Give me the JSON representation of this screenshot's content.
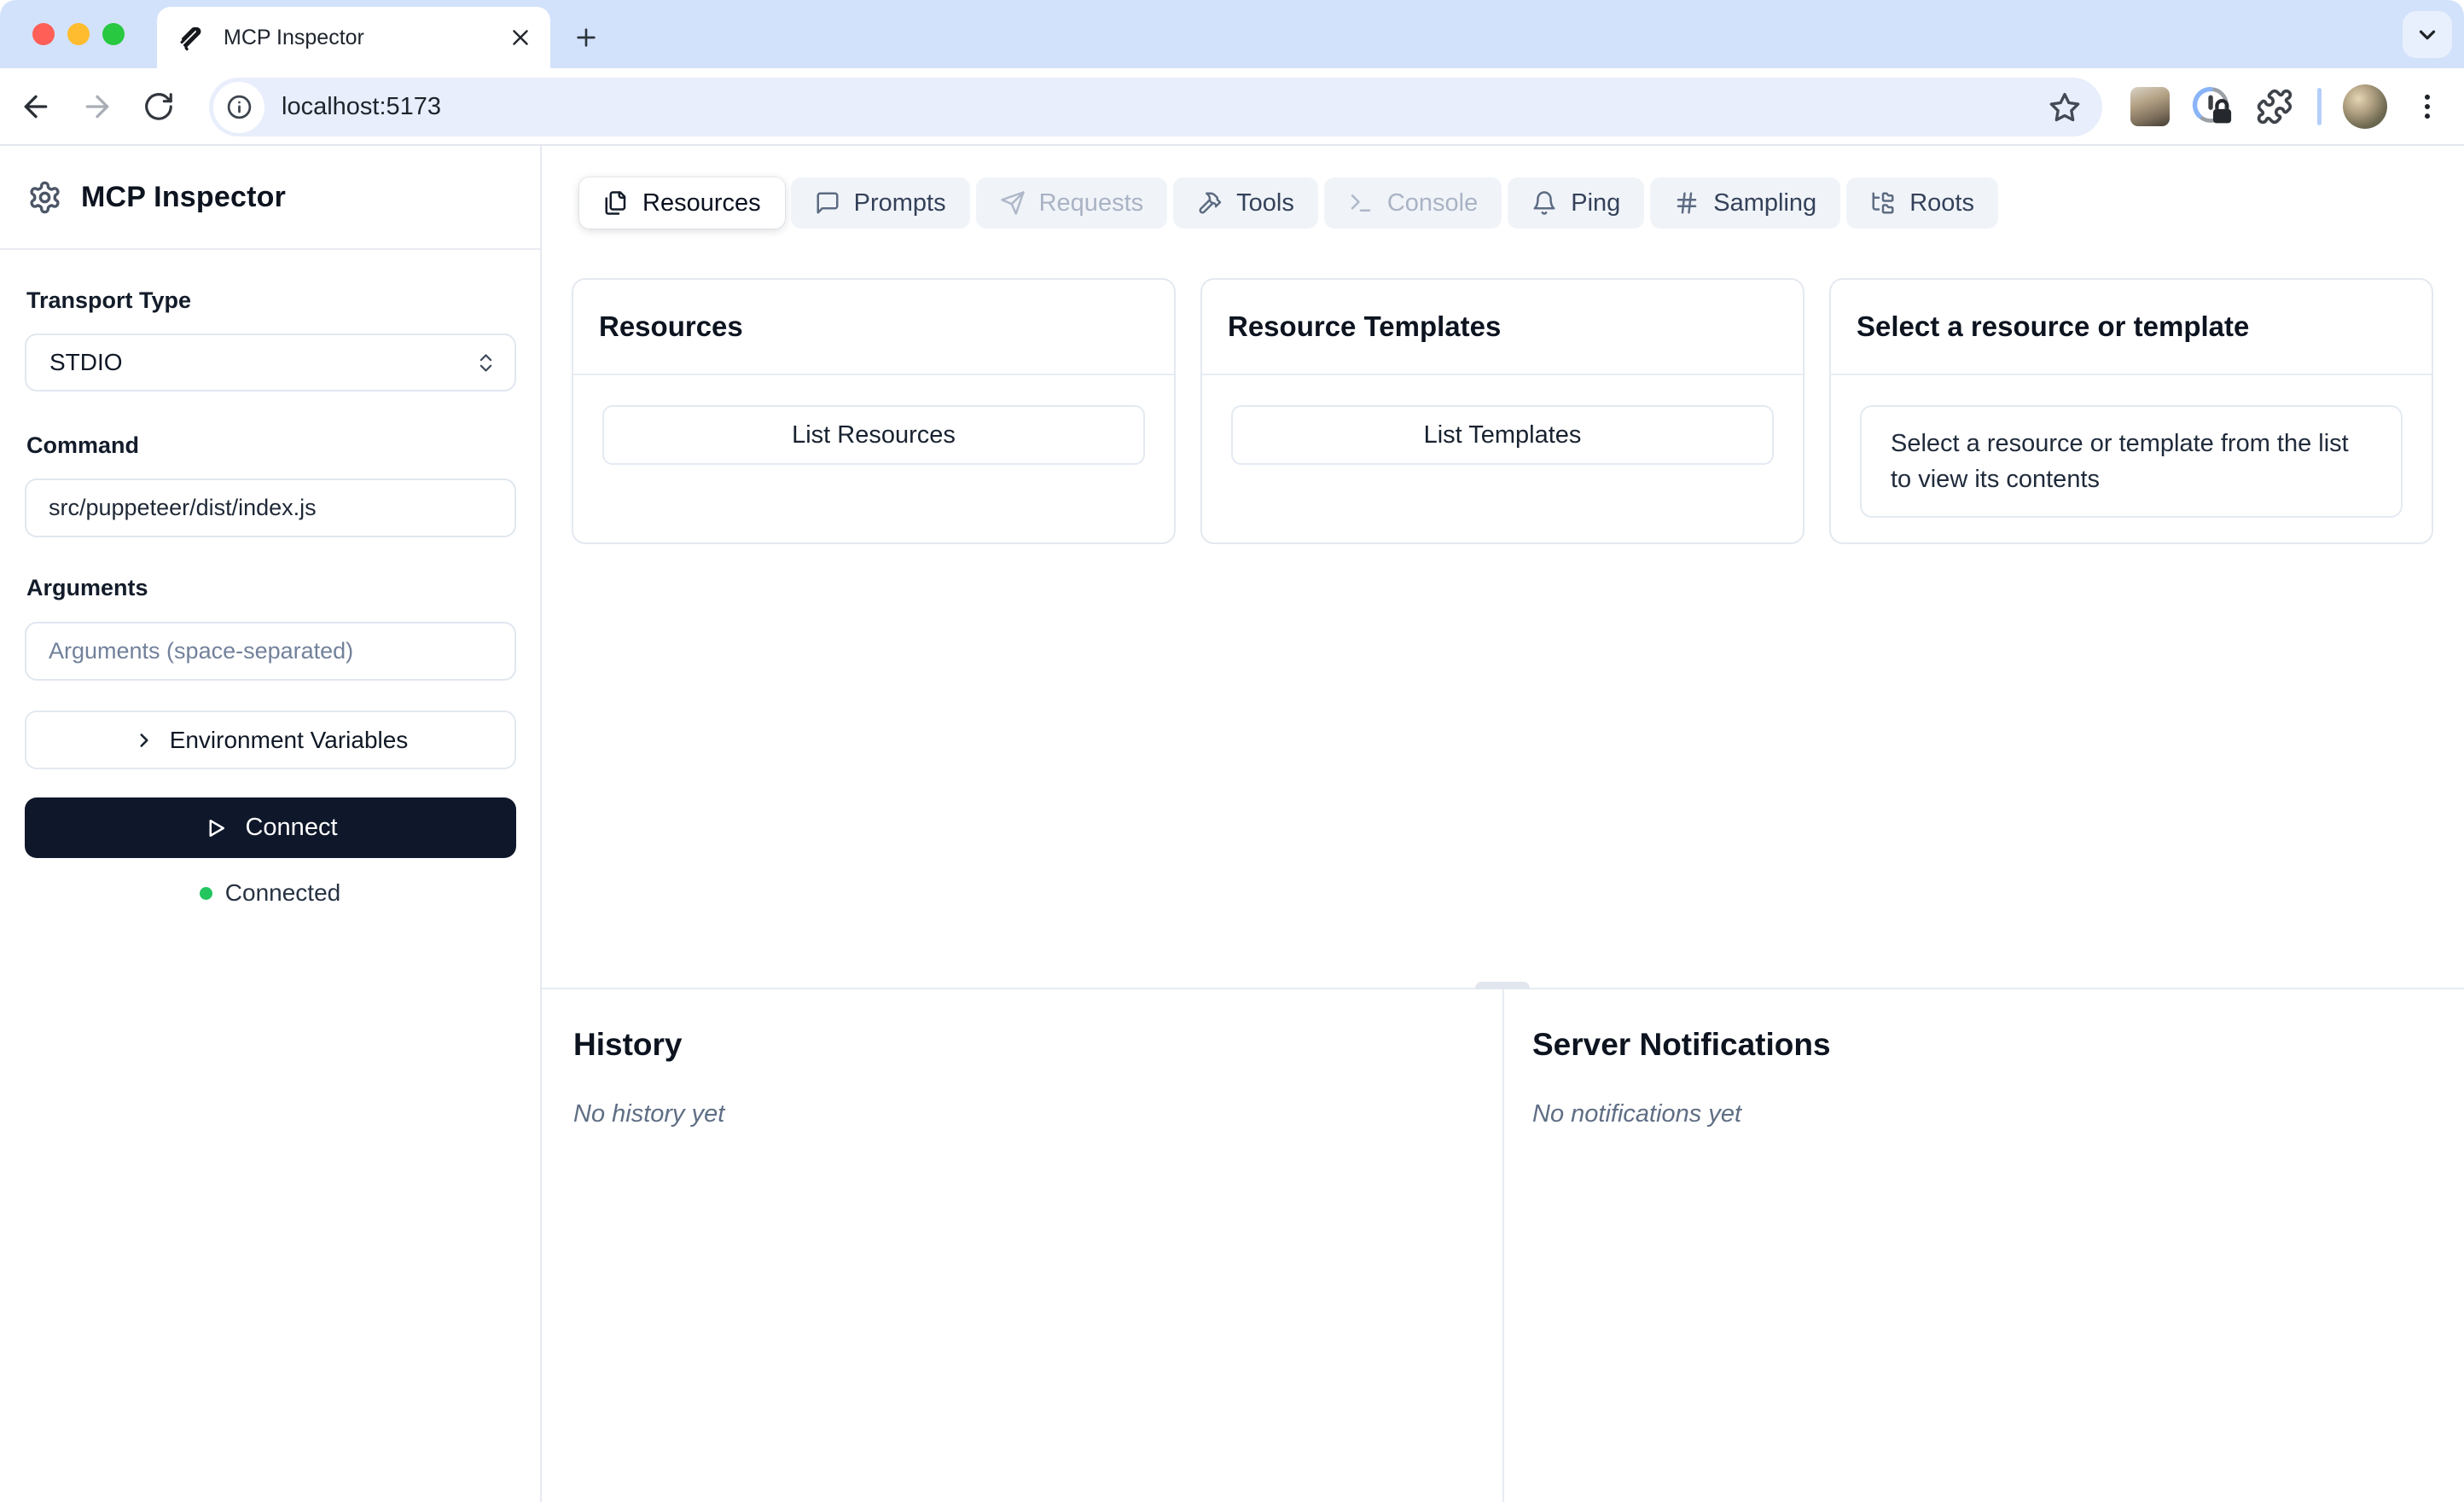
{
  "browser": {
    "tab_title": "MCP Inspector",
    "url": "localhost:5173"
  },
  "sidebar": {
    "app_title": "MCP Inspector",
    "transport_label": "Transport Type",
    "transport_value": "STDIO",
    "command_label": "Command",
    "command_value": "src/puppeteer/dist/index.js",
    "arguments_label": "Arguments",
    "arguments_placeholder": "Arguments (space-separated)",
    "env_button_label": "Environment Variables",
    "connect_button_label": "Connect",
    "status_text": "Connected"
  },
  "tabs": [
    {
      "label": "Resources",
      "icon": "files-icon",
      "state": "active"
    },
    {
      "label": "Prompts",
      "icon": "message-square-icon",
      "state": "enabled"
    },
    {
      "label": "Requests",
      "icon": "send-icon",
      "state": "disabled"
    },
    {
      "label": "Tools",
      "icon": "hammer-icon",
      "state": "enabled"
    },
    {
      "label": "Console",
      "icon": "terminal-icon",
      "state": "disabled"
    },
    {
      "label": "Ping",
      "icon": "bell-icon",
      "state": "enabled"
    },
    {
      "label": "Sampling",
      "icon": "hash-icon",
      "state": "enabled"
    },
    {
      "label": "Roots",
      "icon": "folder-tree-icon",
      "state": "enabled"
    }
  ],
  "cards": {
    "resources": {
      "title": "Resources",
      "button_label": "List Resources"
    },
    "templates": {
      "title": "Resource Templates",
      "button_label": "List Templates"
    },
    "preview": {
      "title": "Select a resource or template",
      "body": "Select a resource or template from the list to view its contents"
    }
  },
  "panels": {
    "history": {
      "title": "History",
      "empty_text": "No history yet"
    },
    "notifications": {
      "title": "Server Notifications",
      "empty_text": "No notifications yet"
    }
  },
  "colors": {
    "connect_button": "#0f172a",
    "status_dot": "#22c55e",
    "traffic_close": "#ff5f57",
    "traffic_minimize": "#febc2e",
    "traffic_zoom": "#28c840",
    "chrome_strip": "#d3e2fb",
    "url_pill": "#e8eefb",
    "active_tab_bg": "#ffffff",
    "inactive_tab_bg": "#f0f4f9"
  }
}
